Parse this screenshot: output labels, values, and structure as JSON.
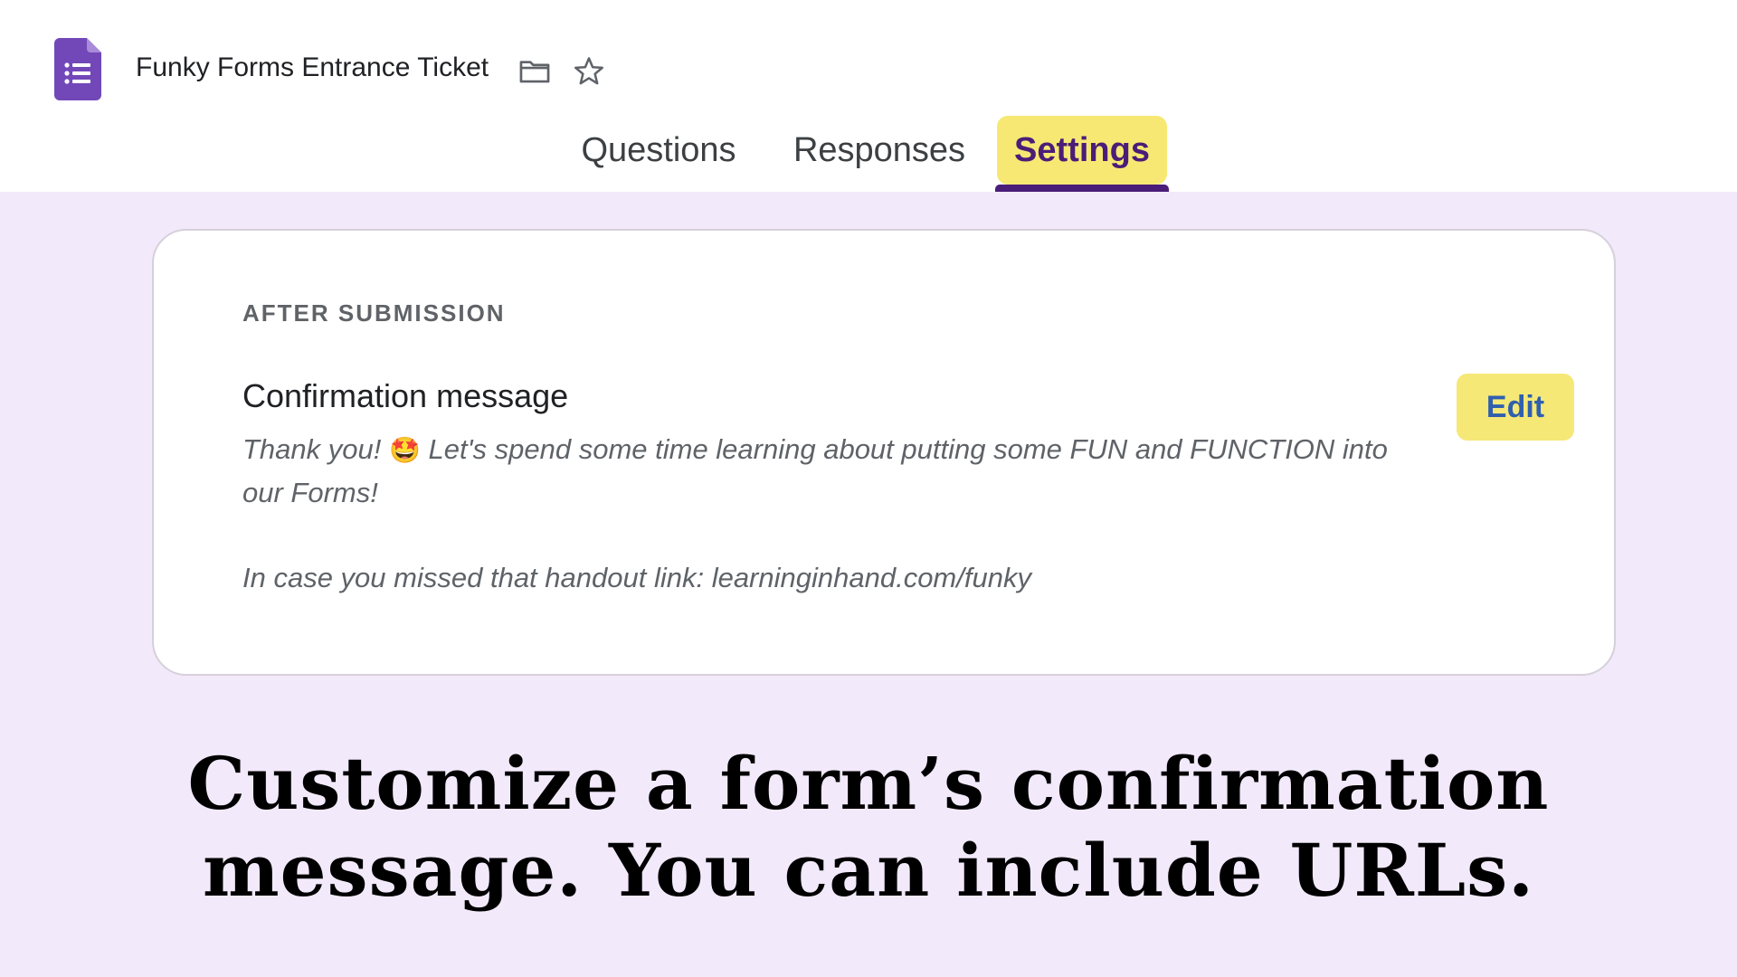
{
  "app": {
    "form_title": "Funky Forms Entrance Ticket",
    "icons": {
      "app": "google-forms-icon",
      "folder": "folder-icon",
      "star": "star-icon"
    }
  },
  "tabs": [
    {
      "label": "Questions",
      "active": false
    },
    {
      "label": "Responses",
      "active": false
    },
    {
      "label": "Settings",
      "active": true
    }
  ],
  "settings": {
    "section_label": "AFTER SUBMISSION",
    "confirmation": {
      "title": "Confirmation message",
      "body_before_emoji": "Thank you!",
      "emoji": "🤩",
      "body_after_emoji": "Let's spend some time learning about putting some FUN and FUNCTION into our Forms!",
      "body_line2": "In case you missed that handout link: learninginhand.com/funky"
    },
    "edit_label": "Edit"
  },
  "caption": {
    "line1": "Customize a form’s confirmation",
    "line2": "message. You can include URLs."
  },
  "colors": {
    "background": "#f2e9fa",
    "accent_purple": "#4a1d78",
    "highlight_yellow": "#f7e873",
    "edit_text_blue": "#2f5fae",
    "forms_icon_purple": "#7248b9"
  }
}
